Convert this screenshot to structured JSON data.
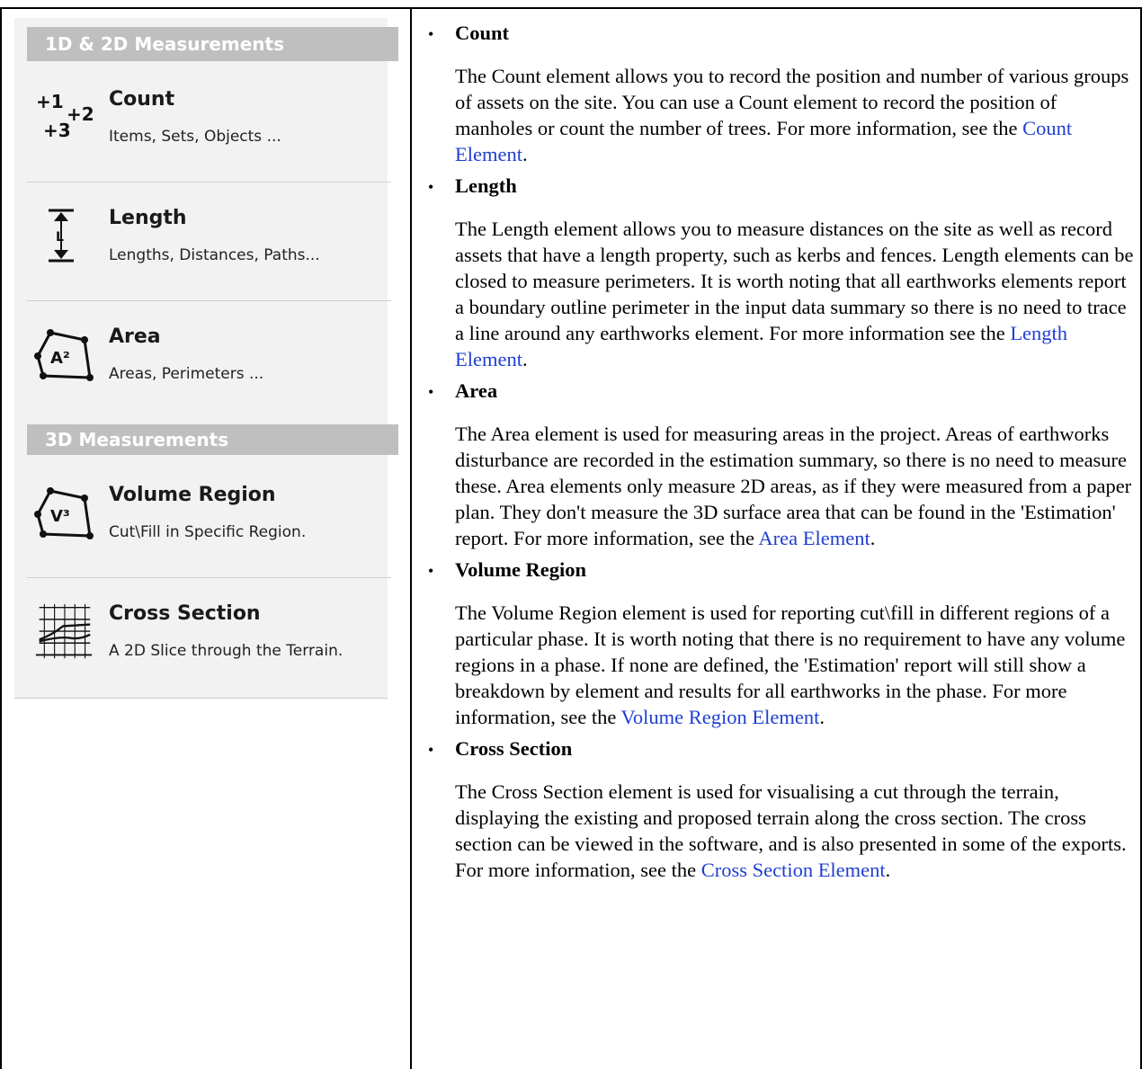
{
  "menu": {
    "section1": "1D & 2D Measurements",
    "section2": "3D Measurements",
    "items": [
      {
        "title": "Count",
        "desc": "Items, Sets, Objects ...",
        "icon": "count-icon"
      },
      {
        "title": "Length",
        "desc": "Lengths, Distances, Paths...",
        "icon": "length-icon"
      },
      {
        "title": "Area",
        "desc": "Areas, Perimeters ...",
        "icon": "area-icon"
      },
      {
        "title": "Volume Region",
        "desc": "Cut\\Fill in Specific Region.",
        "icon": "volume-icon"
      },
      {
        "title": "Cross Section",
        "desc": "A 2D Slice through the Terrain.",
        "icon": "cross-section-icon"
      }
    ],
    "icon_text": {
      "count": [
        "+1",
        "+2",
        "+3"
      ],
      "length": "L",
      "area": "A²",
      "volume": "V³"
    }
  },
  "entries": [
    {
      "term": "Count",
      "text": "The Count element allows you to record the position and number of various groups of assets on the site. You can use a Count element to record the position of manholes or count the number of trees. For more information, see the ",
      "link": "Count Element",
      "end": "."
    },
    {
      "term": "Length",
      "text": "The Length element allows you to measure distances on the site as well as record assets that have a length property, such as kerbs and fences. Length elements can be closed to measure perimeters. It is worth noting that all earthworks elements report a boundary outline perimeter in the input data summary so there is no need to trace a line around any earthworks element. For more information see the ",
      "link": "Length Element",
      "end": "."
    },
    {
      "term": "Area",
      "text": "The Area element is used for measuring areas in the project. Areas of earthworks disturbance are recorded in the estimation summary, so there is no need to measure these. Area elements only measure 2D areas, as if they were measured from a paper plan. They don't measure the 3D surface area that can be found in the 'Estimation' report. For more information, see the ",
      "link": "Area Element",
      "end": "."
    },
    {
      "term": "Volume Region",
      "text": "The Volume Region element is used for reporting cut\\fill in different regions of a particular phase. It is worth noting that there is no requirement to have any volume regions in a phase. If none are defined, the 'Estimation' report will still show a breakdown by element and results for all earthworks in the phase. For more information, see the ",
      "link": "Volume Region Element",
      "end": "."
    },
    {
      "term": "Cross Section",
      "text": "The Cross Section element is used for visualising a cut through the terrain, displaying the existing and proposed terrain along the cross section. The cross section can be viewed in the software, and is also presented in some of the exports. For more information, see the ",
      "link": "Cross Section Element",
      "end": "."
    }
  ],
  "colors": {
    "link": "#1f3fd1",
    "header_bg": "#bfbfbf",
    "panel_bg": "#f2f2f2"
  }
}
